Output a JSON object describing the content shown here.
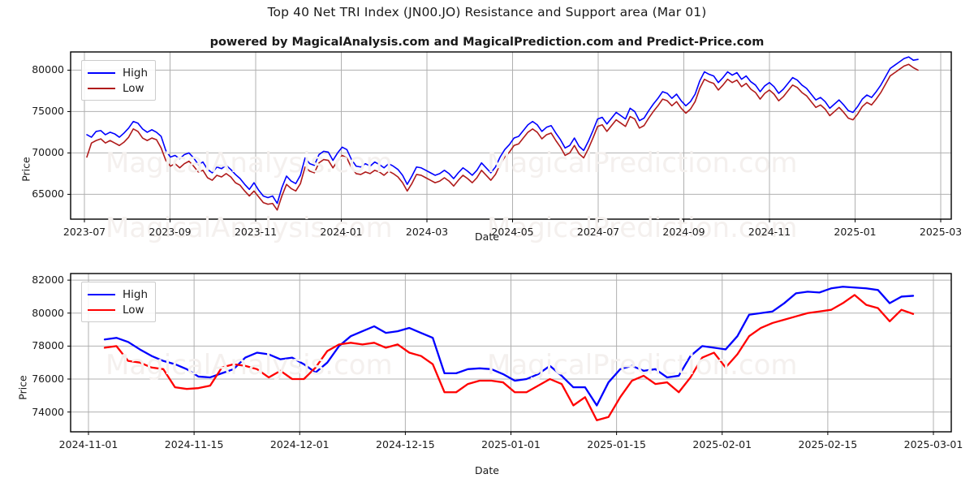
{
  "header": {
    "title": "Top 40 Net TRI Index (JN00.JO) Resistance and Support area (Mar 01)",
    "subtitle": "powered by MagicalAnalysis.com and MagicalPrediction.com and Predict-Price.com"
  },
  "watermarks": {
    "top_left": "MagicalAnalysis.com",
    "top_right": "MagicalPrediction.com",
    "mid_left": "MagicalAnalysis.com",
    "mid_right": "MagicalPrediction.com",
    "bottom_left": "MagicalAnalysis.com",
    "bottom_right": "MagicalPrediction.com"
  },
  "colors": {
    "high": "#0000ff",
    "low_top": "#b01b1b",
    "low_bottom": "#ff0000",
    "grid": "#b0b0b0",
    "frame": "#000000",
    "watermark": "#f4f0ee"
  },
  "legend": {
    "high_label": "High",
    "low_label": "Low"
  },
  "chart_data": [
    {
      "id": "overview",
      "type": "line",
      "title": "Top 40 Net TRI Index (JN00.JO) Resistance and Support area (Mar 01)",
      "xlabel": "Date",
      "ylabel": "Price",
      "ylim": [
        62000,
        82200
      ],
      "yticks": [
        65000,
        70000,
        75000,
        80000
      ],
      "ytick_labels": [
        "65000",
        "70000",
        "75000",
        "80000"
      ],
      "xlim": [
        "2023-06-20",
        "2025-03-20"
      ],
      "xticks": [
        "2023-07",
        "2023-09",
        "2023-11",
        "2024-01",
        "2024-03",
        "2024-05",
        "2024-07",
        "2024-09",
        "2024-11",
        "2025-01",
        "2025-03"
      ],
      "grid": true,
      "legend_position": "upper left",
      "series": [
        {
          "name": "High",
          "color": "#0000ff",
          "values": [
            72200,
            71900,
            72600,
            72700,
            72200,
            72500,
            72300,
            71900,
            72400,
            73000,
            73800,
            73600,
            72900,
            72500,
            72800,
            72500,
            72000,
            70300,
            69500,
            69700,
            69300,
            69800,
            70000,
            69400,
            68600,
            68900,
            68000,
            67600,
            68300,
            68100,
            68500,
            68000,
            67400,
            66900,
            66200,
            65600,
            66400,
            65500,
            64800,
            64600,
            64800,
            63900,
            65800,
            67200,
            66600,
            66300,
            67300,
            69400,
            68700,
            68500,
            69800,
            70200,
            70100,
            69100,
            70000,
            70700,
            70400,
            69200,
            68400,
            68300,
            68700,
            68400,
            68900,
            68600,
            68200,
            68700,
            68400,
            68000,
            67300,
            66200,
            67200,
            68300,
            68200,
            67900,
            67600,
            67300,
            67500,
            67900,
            67500,
            66900,
            67600,
            68200,
            67800,
            67300,
            67900,
            68800,
            68200,
            67600,
            68300,
            69500,
            70400,
            71000,
            71800,
            72000,
            72700,
            73400,
            73800,
            73400,
            72600,
            73100,
            73300,
            72400,
            71600,
            70600,
            70900,
            71800,
            70800,
            70300,
            71400,
            72700,
            74100,
            74300,
            73500,
            74200,
            74900,
            74500,
            74100,
            75400,
            75000,
            73900,
            74200,
            75100,
            75900,
            76600,
            77400,
            77200,
            76600,
            77100,
            76300,
            75700,
            76200,
            77100,
            78700,
            79800,
            79500,
            79300,
            78500,
            79100,
            79800,
            79400,
            79700,
            78900,
            79300,
            78600,
            78200,
            77400,
            78100,
            78500,
            78000,
            77200,
            77700,
            78400,
            79100,
            78800,
            78200,
            77800,
            77100,
            76400,
            76700,
            76200,
            75400,
            75900,
            76400,
            75800,
            75100,
            74900,
            75600,
            76500,
            77000,
            76700,
            77400,
            78200,
            79200,
            80200,
            80600,
            81000,
            81400,
            81600,
            81200,
            81300
          ]
        },
        {
          "name": "Low",
          "color": "#b01b1b",
          "values": [
            69500,
            71200,
            71500,
            71700,
            71200,
            71500,
            71200,
            70900,
            71300,
            71900,
            72900,
            72600,
            71800,
            71500,
            71800,
            71600,
            70600,
            69100,
            68400,
            68700,
            68200,
            68700,
            69000,
            68400,
            67700,
            67900,
            67000,
            66700,
            67300,
            67100,
            67500,
            67100,
            66400,
            66100,
            65400,
            64800,
            65400,
            64700,
            64000,
            63800,
            63900,
            63100,
            64800,
            66200,
            65700,
            65400,
            66300,
            68300,
            67800,
            67600,
            68800,
            69200,
            69100,
            68200,
            69000,
            69700,
            69400,
            68200,
            67500,
            67400,
            67700,
            67500,
            67900,
            67700,
            67300,
            67800,
            67500,
            67100,
            66400,
            65400,
            66300,
            67400,
            67300,
            67000,
            66700,
            66400,
            66600,
            67000,
            66600,
            66000,
            66700,
            67300,
            66900,
            66400,
            67000,
            67900,
            67300,
            66700,
            67400,
            68600,
            69500,
            70100,
            70900,
            71100,
            71800,
            72500,
            72900,
            72500,
            71700,
            72200,
            72400,
            71500,
            70700,
            69700,
            70000,
            70900,
            69900,
            69400,
            70500,
            71800,
            73200,
            73400,
            72600,
            73300,
            74000,
            73600,
            73200,
            74400,
            74100,
            73000,
            73300,
            74200,
            75000,
            75700,
            76500,
            76300,
            75700,
            76200,
            75400,
            74800,
            75300,
            76200,
            77800,
            78900,
            78600,
            78400,
            77600,
            78200,
            78900,
            78500,
            78800,
            78000,
            78400,
            77700,
            77300,
            76500,
            77200,
            77600,
            77100,
            76300,
            76800,
            77500,
            78200,
            77900,
            77300,
            76900,
            76200,
            75500,
            75800,
            75300,
            74500,
            75000,
            75500,
            74900,
            74200,
            74000,
            74700,
            75600,
            76100,
            75800,
            76500,
            77300,
            78300,
            79300,
            79700,
            80100,
            80500,
            80700,
            80300,
            80000
          ]
        }
      ]
    },
    {
      "id": "detail",
      "type": "line",
      "xlabel": "Date",
      "ylabel": "Price",
      "ylim": [
        72800,
        82400
      ],
      "yticks": [
        74000,
        76000,
        78000,
        80000,
        82000
      ],
      "ytick_labels": [
        "74000",
        "76000",
        "78000",
        "80000",
        "82000"
      ],
      "xlim": [
        "2024-10-28",
        "2025-03-05"
      ],
      "xticks": [
        "2024-11-01",
        "2024-11-15",
        "2024-12-01",
        "2024-12-15",
        "2025-01-01",
        "2025-01-15",
        "2025-02-01",
        "2025-02-15",
        "2025-03-01"
      ],
      "grid": true,
      "legend_position": "upper left",
      "series": [
        {
          "name": "High",
          "color": "#0000ff",
          "values": [
            78400,
            78500,
            78250,
            77800,
            77400,
            77100,
            76900,
            76600,
            76150,
            76100,
            76350,
            76600,
            77300,
            77600,
            77500,
            77200,
            77300,
            76900,
            76400,
            77000,
            78000,
            78600,
            78900,
            79200,
            78800,
            78900,
            79100,
            78800,
            78500,
            76350,
            76350,
            76600,
            76650,
            76600,
            76300,
            75900,
            76000,
            76300,
            76800,
            76200,
            75500,
            75500,
            74400,
            75800,
            76600,
            76800,
            76500,
            76600,
            76100,
            76200,
            77400,
            78000,
            77900,
            77800,
            78600,
            79900,
            80000,
            80100,
            80600,
            81200,
            81300,
            81250,
            81500,
            81600,
            81550,
            81500,
            81400,
            80600,
            81000,
            81050
          ]
        },
        {
          "name": "Low",
          "color": "#ff0000",
          "values": [
            77900,
            78000,
            77100,
            77000,
            76700,
            76600,
            75500,
            75400,
            75450,
            75600,
            76700,
            76900,
            76800,
            76600,
            76100,
            76500,
            76000,
            76000,
            76700,
            77700,
            78100,
            78200,
            78100,
            78200,
            77900,
            78100,
            77600,
            77400,
            76900,
            75200,
            75200,
            75700,
            75900,
            75900,
            75800,
            75200,
            75200,
            75600,
            76000,
            75700,
            74400,
            74900,
            73500,
            73700,
            74900,
            75900,
            76200,
            75700,
            75800,
            75200,
            76100,
            77300,
            77600,
            76700,
            77500,
            78600,
            79100,
            79400,
            79600,
            79800,
            80000,
            80100,
            80200,
            80600,
            81100,
            80500,
            80300,
            79500,
            80200,
            79950
          ]
        }
      ]
    }
  ]
}
